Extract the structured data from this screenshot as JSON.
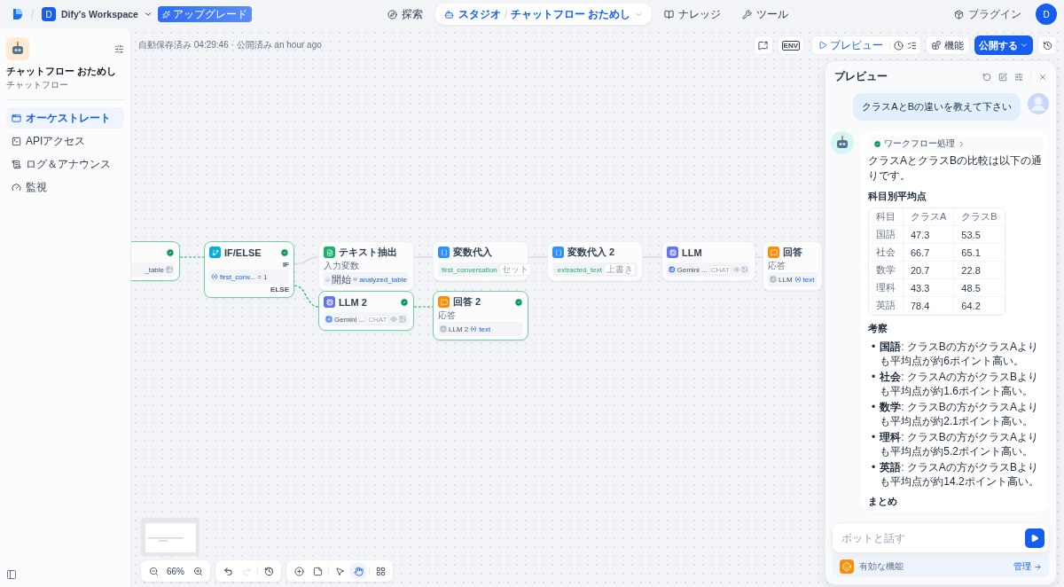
{
  "topbar": {
    "workspace_initial": "D",
    "workspace": "Dify's Workspace",
    "upgrade": "アップグレード",
    "nav": [
      {
        "label": "探索",
        "kind": "explore",
        "selected": false
      },
      {
        "label": "スタジオ",
        "kind": "studio",
        "selected": true,
        "app": "チャットフロー おためし"
      },
      {
        "label": "ナレッジ",
        "kind": "knowledge",
        "selected": false
      },
      {
        "label": "ツール",
        "kind": "tools",
        "selected": false
      }
    ],
    "plugins": "プラグイン",
    "avatar": "D"
  },
  "sidebar": {
    "app_title": "チャットフロー おためし",
    "app_type": "チャットフロー",
    "items": [
      {
        "label": "オーケストレート",
        "kind": "orchestrate",
        "selected": true
      },
      {
        "label": "APIアクセス",
        "kind": "api",
        "selected": false
      },
      {
        "label": "ログ＆アナウンス",
        "kind": "logs",
        "selected": false
      },
      {
        "label": "監視",
        "kind": "monitor",
        "selected": false
      }
    ]
  },
  "canvas": {
    "status": "自動保存済み 04:29:46 · 公開済み an hour ago",
    "toolbar": {
      "env": "ENV",
      "preview": "プレビュー",
      "features": "機能",
      "publish": "公開する"
    },
    "nodes": [
      {
        "kind": "field",
        "succeeded": true,
        "value": "_table"
      },
      {
        "kind": "condition",
        "title": "IF/ELSE",
        "succeeded": true,
        "variable": "first_conv...",
        "operator": "=",
        "operand": "1",
        "branches": [
          "IF",
          "ELSE"
        ]
      },
      {
        "kind": "extract",
        "title": "テキスト抽出",
        "succeeded": false,
        "caption": "入力変数",
        "source": "開始",
        "variable": "analyzed_table"
      },
      {
        "kind": "assign",
        "title": "変数代入",
        "succeeded": false,
        "variable": "first_conversation",
        "mode": "セット"
      },
      {
        "kind": "assign",
        "title": "変数代入 2",
        "succeeded": false,
        "variable": "extracted_text",
        "mode": "上書き"
      },
      {
        "kind": "llm",
        "title": "LLM",
        "succeeded": false,
        "model": "Gemini ...",
        "mode": "CHAT"
      },
      {
        "kind": "answer",
        "title": "回答",
        "succeeded": false,
        "caption": "応答",
        "source": "LLM",
        "variable": "text"
      },
      {
        "kind": "llm",
        "title": "LLM 2",
        "succeeded": true,
        "model": "Gemini ...",
        "mode": "CHAT"
      },
      {
        "kind": "answer",
        "title": "回答 2",
        "succeeded": true,
        "caption": "応答",
        "source": "LLM 2",
        "variable": "text"
      }
    ],
    "zoom": "66%",
    "tools": [
      {
        "kind": "undo",
        "disabled": false
      },
      {
        "kind": "redo",
        "disabled": true
      },
      {
        "kind": "history",
        "disabled": false
      }
    ],
    "modes": [
      {
        "kind": "add",
        "selected": false
      },
      {
        "kind": "note",
        "selected": false
      },
      {
        "kind": "pointer",
        "selected": false
      },
      {
        "kind": "hand",
        "selected": true
      },
      {
        "kind": "layout",
        "selected": false
      }
    ]
  },
  "preview": {
    "title": "プレビュー",
    "user_message": "クラスAとBの違いを教えて下さい",
    "workflow_badge": "ワークフロー処理",
    "intro": "クラスAとクラスBの比較は以下の通りです。",
    "table_heading": "科目別平均点",
    "table": {
      "columns": [
        "科目",
        "クラスA",
        "クラスB"
      ],
      "rows": [
        [
          "国語",
          "47.3",
          "53.5"
        ],
        [
          "社会",
          "66.7",
          "65.1"
        ],
        [
          "数学",
          "20.7",
          "22.8"
        ],
        [
          "理科",
          "43.3",
          "48.5"
        ],
        [
          "英語",
          "78.4",
          "64.2"
        ]
      ]
    },
    "notes_heading": "考察",
    "notes": [
      {
        "marker": "•",
        "text": "**国語**: クラスBの方がクラスAよりも平均点が約6ポイント高い。"
      },
      {
        "marker": "•",
        "text": "**社会**: クラスAの方がクラスBよりも平均点が約1.6ポイント高い。"
      },
      {
        "marker": "•",
        "text": "**数学**: クラスBの方がクラスAよりも平均点が約2.1ポイント高い。"
      },
      {
        "marker": "•",
        "text": "**理科**: クラスBの方がクラスAよりも平均点が約5.2ポイント高い。"
      },
      {
        "marker": "•",
        "text": "**英語**: クラスAの方がクラスBよりも平均点が約14.2ポイント高い。"
      }
    ],
    "summary_heading": "まとめ",
    "input_placeholder": "ボットと話す",
    "features": "有効な機能",
    "manage": "管理"
  }
}
